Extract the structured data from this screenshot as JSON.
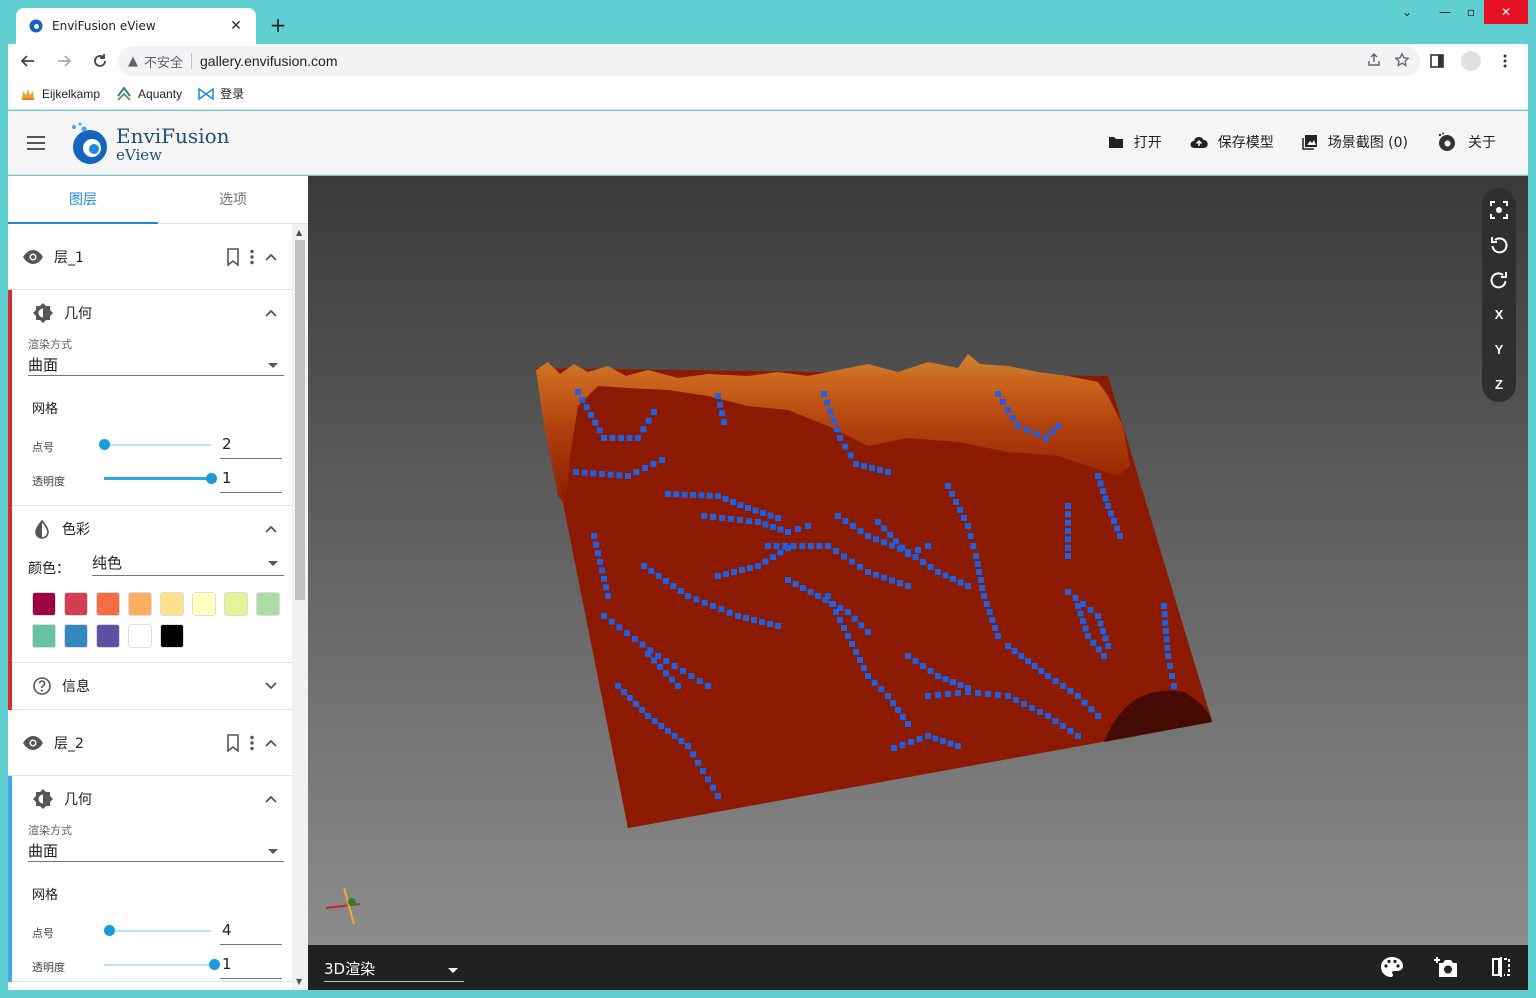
{
  "browser": {
    "tab_title": "EnviFusion eView",
    "security_label": "不安全",
    "url": "gallery.envifusion.com",
    "bookmarks": [
      {
        "label": "Eijkelkamp"
      },
      {
        "label": "Aquanty"
      },
      {
        "label": "登录"
      }
    ]
  },
  "app": {
    "brand_line1": "EnviFusion",
    "brand_line2": "eView",
    "actions": {
      "open": "打开",
      "save": "保存模型",
      "screenshot": "场景截图 (0)",
      "about": "关于"
    }
  },
  "panel": {
    "tabs": [
      "图层",
      "选项"
    ],
    "layers": [
      {
        "name": "层_1",
        "geometry_title": "几何",
        "render_label": "渲染方式",
        "render_value": "曲面",
        "grid_title": "网格",
        "point_label": "点号",
        "point_value": "2",
        "point_fraction": 0.0,
        "opacity_label": "透明度",
        "opacity_value": "1",
        "opacity_fraction": 1.0,
        "color_title": "色彩",
        "color_label": "颜色：",
        "color_value": "纯色",
        "info_title": "信息"
      },
      {
        "name": "层_2",
        "geometry_title": "几何",
        "render_label": "渲染方式",
        "render_value": "曲面",
        "grid_title": "网格",
        "point_label": "点号",
        "point_value": "4",
        "point_fraction": 0.05,
        "opacity_label": "透明度",
        "opacity_value": "1"
      }
    ],
    "swatch_colors": [
      "#9e0142",
      "#d53e4f",
      "#f46d43",
      "#fdae61",
      "#fee08b",
      "#ffffbf",
      "#e6f598",
      "#abdda4",
      "#66c2a5",
      "#3288bd",
      "#5e4fa2",
      "#ffffff",
      "#000000"
    ]
  },
  "viewport": {
    "view_buttons": [
      "X",
      "Y",
      "Z"
    ],
    "render_mode": "3D渲染"
  },
  "colors": {
    "accent": "#1e88e5",
    "terrain": "#8b1a00",
    "streams": "#1f5fe0"
  }
}
